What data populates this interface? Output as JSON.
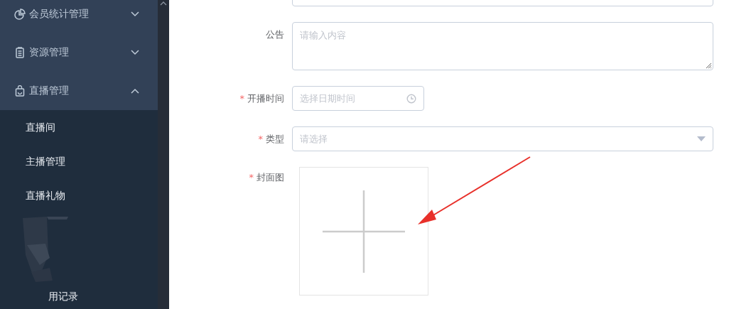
{
  "sidebar": {
    "menus": [
      {
        "label": "会员统计管理",
        "expanded": false
      },
      {
        "label": "资源管理",
        "expanded": false
      },
      {
        "label": "直播管理",
        "expanded": true,
        "children": [
          {
            "label": "直播间"
          },
          {
            "label": "主播管理"
          },
          {
            "label": "直播礼物"
          }
        ],
        "after_redaction": [
          {
            "label": "用记录"
          }
        ]
      }
    ]
  },
  "form": {
    "required_mark": "*",
    "fields": [
      {
        "kind": "input"
      },
      {
        "kind": "textarea",
        "label": "公告",
        "required": false,
        "placeholder": "请输入内容"
      },
      {
        "kind": "datetime",
        "label": "开播时间",
        "required": true,
        "placeholder": "选择日期时间"
      },
      {
        "kind": "select",
        "label": "类型",
        "required": true,
        "placeholder": "请选择"
      },
      {
        "kind": "upload",
        "label": "封面图",
        "required": true
      }
    ]
  }
}
